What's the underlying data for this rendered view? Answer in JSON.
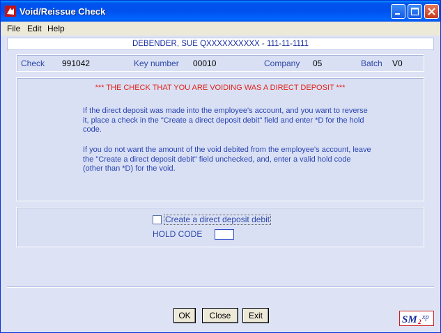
{
  "window": {
    "title": "Void/Reissue Check"
  },
  "menu": {
    "file": "File",
    "edit": "Edit",
    "help": "Help"
  },
  "employee": {
    "header": "DEBENDER, SUE QXXXXXXXXXX - 111-11-1111"
  },
  "fields": {
    "check_label": "Check",
    "check_value": "991042",
    "key_label": "Key number",
    "key_value": "00010",
    "company_label": "Company",
    "company_value": "05",
    "batch_label": "Batch",
    "batch_value": "V0"
  },
  "notice": {
    "warning": "*** THE CHECK THAT YOU ARE VOIDING WAS A DIRECT DEPOSIT ***",
    "paragraph1": "If the direct deposit was made into the employee's account, and you want to reverse it, place a check in the  \"Create a direct deposit debit\" field and enter *D for the hold code.",
    "paragraph2": "If you do not want the amount of the void debited from the employee's account, leave the  \"Create a direct deposit debit\" field unchecked, and, enter a valid hold code (other than *D) for the void."
  },
  "options": {
    "debit_label": "Create a direct deposit debit",
    "debit_checked": false,
    "hold_code_label": "HOLD CODE",
    "hold_code_value": ""
  },
  "buttons": {
    "ok": "OK",
    "close": "Close",
    "exit": "Exit"
  },
  "logo": {
    "text": "SM2xp"
  },
  "colors": {
    "titlebar": "#0053ee",
    "background": "#dde3f5",
    "warning": "#e2231a",
    "label": "#2f48a8"
  }
}
